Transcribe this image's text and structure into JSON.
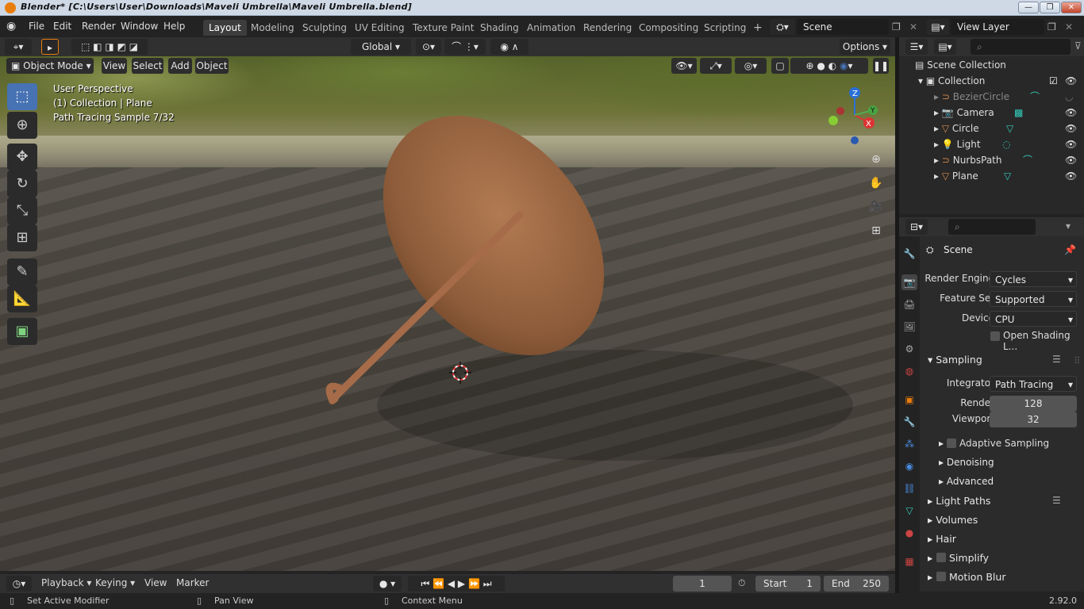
{
  "window": {
    "title": "Blender* [C:\\Users\\User\\Downloads\\Maveli Umbrella\\Maveli Umbrella.blend]",
    "min": "—",
    "max": "❐",
    "close": "✕"
  },
  "menu": [
    "File",
    "Edit",
    "Render",
    "Window",
    "Help"
  ],
  "workspaces": [
    "Layout",
    "Modeling",
    "Sculpting",
    "UV Editing",
    "Texture Paint",
    "Shading",
    "Animation",
    "Rendering",
    "Compositing",
    "Scripting"
  ],
  "active_workspace": "Layout",
  "add_tab": "+",
  "scene_field": "Scene",
  "view_layer_field": "View Layer",
  "viewport_header": {
    "mode": "Object Mode",
    "view": "View",
    "select": "Select",
    "add": "Add",
    "object": "Object",
    "transform": "Global",
    "options": "Options"
  },
  "overlay": {
    "perspective": "User Perspective",
    "collection": "(1) Collection | Plane",
    "sample": "Path Tracing Sample 7/32"
  },
  "gizmo": {
    "z": "Z",
    "y": "Y",
    "x": "X"
  },
  "outliner": {
    "root": "Scene Collection",
    "collection": "Collection",
    "items": [
      "BezierCircle",
      "Camera",
      "Circle",
      "Light",
      "NurbsPath",
      "Plane"
    ]
  },
  "properties": {
    "context": "Scene",
    "render_engine_label": "Render Engine",
    "render_engine": "Cycles",
    "feature_set_label": "Feature Set",
    "feature_set": "Supported",
    "device_label": "Device",
    "device": "CPU",
    "open_shading": "Open Shading L...",
    "sampling": "Sampling",
    "integrator_label": "Integrator",
    "integrator": "Path Tracing",
    "render_label": "Render",
    "render": "128",
    "viewport_label": "Viewport",
    "viewport": "32",
    "adaptive": "Adaptive Sampling",
    "denoising": "Denoising",
    "advanced": "Advanced",
    "light_paths": "Light Paths",
    "volumes": "Volumes",
    "hair": "Hair",
    "simplify": "Simplify",
    "motion_blur": "Motion Blur"
  },
  "timeline": {
    "playback": "Playback",
    "keying": "Keying",
    "view": "View",
    "marker": "Marker",
    "frame": "1",
    "start_label": "Start",
    "start": "1",
    "end_label": "End",
    "end": "250"
  },
  "status": {
    "left": "Set Active Modifier",
    "mid": "Pan View",
    "right": "Context Menu",
    "version": "2.92.0"
  },
  "colors": {
    "accent": "#4772b3",
    "orange": "#e87d0d"
  }
}
